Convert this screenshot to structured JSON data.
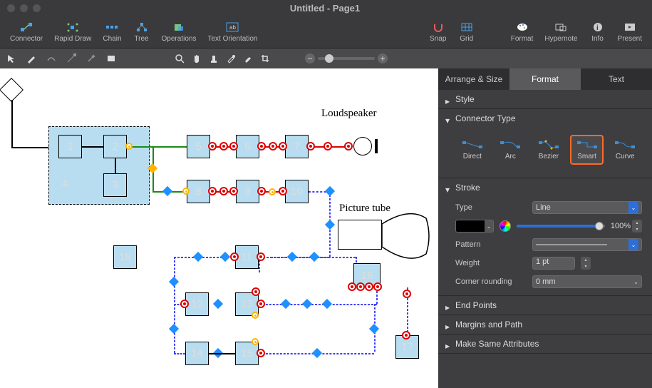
{
  "title": "Untitled - Page1",
  "toolbar1": {
    "items": [
      "Connector",
      "Rapid Draw",
      "Chain",
      "Tree",
      "Operations",
      "Text Orientation"
    ],
    "right": [
      "Snap",
      "Grid",
      "Format",
      "Hypernote",
      "Info",
      "Present"
    ]
  },
  "zoom": {
    "value": 15
  },
  "panel": {
    "tabs": [
      "Arrange & Size",
      "Format",
      "Text"
    ],
    "active_tab": 1,
    "sections": {
      "style": {
        "label": "Style",
        "open": false
      },
      "connector_type": {
        "label": "Connector Type",
        "open": true,
        "types": [
          "Direct",
          "Arc",
          "Bezier",
          "Smart",
          "Curve"
        ],
        "selected": 3
      },
      "stroke": {
        "label": "Stroke",
        "open": true,
        "type_label": "Type",
        "type_value": "Line",
        "color": "#000000",
        "opacity_pct": "100%",
        "pattern_label": "Pattern",
        "weight_label": "Weight",
        "weight_value": "1 pt",
        "corner_label": "Corner rounding",
        "corner_value": "0 mm"
      },
      "end_points": {
        "label": "End Points"
      },
      "margins_path": {
        "label": "Margins and Path"
      },
      "same_attrs": {
        "label": "Make Same Attributes"
      }
    }
  },
  "diagram": {
    "labels": {
      "loudspeaker": "Loudspeaker",
      "picture_tube": "Picture tube"
    },
    "boxes": {
      "b1": "1",
      "b2": "2",
      "b3": "3",
      "b4": "4",
      "b5": "5",
      "b6": "6",
      "b7": "7",
      "b8": "8",
      "b9": "9",
      "b10": "10",
      "b11": "11",
      "b12": "12",
      "b13": "13",
      "b14": "14",
      "b15": "15",
      "b16": "16",
      "b17": "17",
      "b18": "18"
    }
  }
}
